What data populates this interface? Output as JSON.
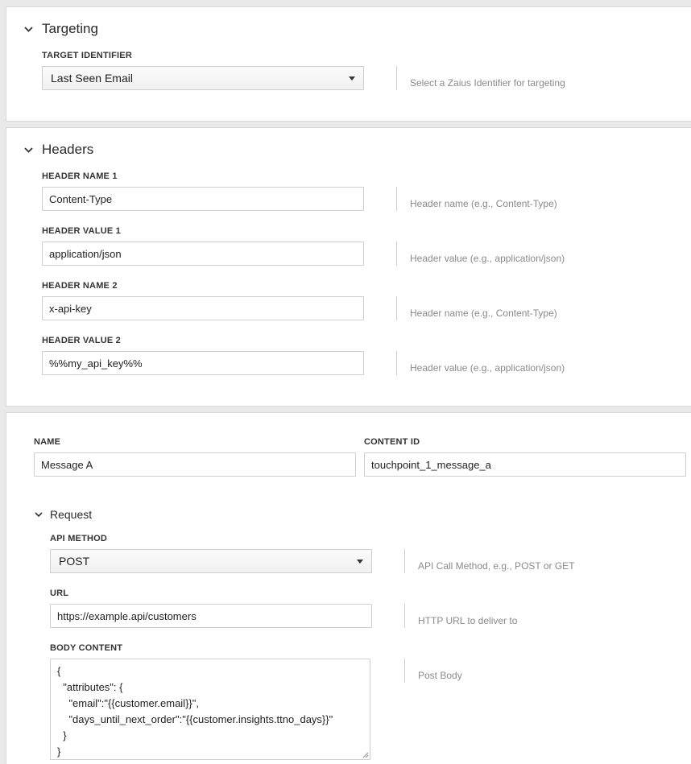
{
  "targeting": {
    "title": "Targeting",
    "target_identifier_label": "TARGET IDENTIFIER",
    "target_identifier_value": "Last Seen Email",
    "target_identifier_help": "Select a Zaius Identifier for targeting"
  },
  "headers": {
    "title": "Headers",
    "fields": [
      {
        "label": "HEADER NAME 1",
        "value": "Content-Type",
        "help": "Header name (e.g., Content-Type)"
      },
      {
        "label": "HEADER VALUE 1",
        "value": "application/json",
        "help": "Header value (e.g., application/json)"
      },
      {
        "label": "HEADER NAME 2",
        "value": "x-api-key",
        "help": "Header name (e.g., Content-Type)"
      },
      {
        "label": "HEADER VALUE 2",
        "value": "%%my_api_key%%",
        "help": "Header value (e.g., application/json)"
      }
    ]
  },
  "message": {
    "name_label": "NAME",
    "name_value": "Message A",
    "content_id_label": "CONTENT ID",
    "content_id_value": "touchpoint_1_message_a",
    "request": {
      "title": "Request",
      "api_method_label": "API METHOD",
      "api_method_value": "POST",
      "api_method_help": "API Call Method, e.g., POST or GET",
      "url_label": "URL",
      "url_value": "https://example.api/customers",
      "url_help": "HTTP URL to deliver to",
      "body_label": "BODY CONTENT",
      "body_value": "{\n  \"attributes\": {\n    \"email\":\"{{customer.email}}\",\n    \"days_until_next_order\":\"{{customer.insights.ttno_days}}\"\n  }\n}",
      "body_help": "Post Body"
    }
  },
  "icons": {
    "section_toggle": "chevron-down-icon",
    "select_caret": "caret-down-icon",
    "resize_handle": "resize-grip-icon"
  }
}
